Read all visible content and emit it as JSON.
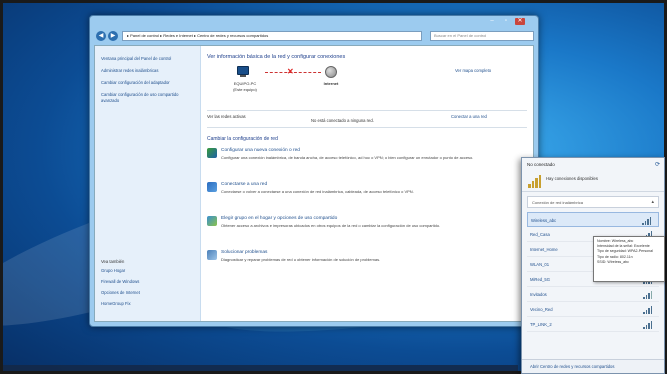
{
  "window": {
    "controls": [
      "–",
      "▫",
      "✕"
    ],
    "address": "▸ Panel de control ▸ Redes e Internet ▸ Centro de redes y recursos compartidos",
    "search_placeholder": "Buscar en el Panel de control"
  },
  "sidebar": {
    "links": [
      "Ventana principal del Panel de control",
      "Administrar redes inalámbricas",
      "Cambiar configuración del adaptador",
      "Cambiar configuración de uso compartido avanzado"
    ],
    "see_also": "Vea también",
    "bottom_links": [
      "Grupo Hogar",
      "Firewall de Windows",
      "Opciones de Internet",
      "HomeGroup Fix"
    ]
  },
  "main": {
    "title": "Ver información básica de la red y configurar conexiones",
    "full_map_link": "Ver mapa completo",
    "pc_label": "EQUIPO-PC",
    "pc_sublabel": "(Este equipo)",
    "internet_label": "Internet",
    "active_networks_label": "Ver las redes activas",
    "connect_link": "Conectar a una red",
    "not_connected": "No está conectado a ninguna red.",
    "change_settings_title": "Cambiar la configuración de red",
    "tasks": [
      {
        "link": "Configurar una nueva conexión o red",
        "desc": "Configurar una conexión inalámbrica, de banda ancha, de acceso telefónico, ad hoc o VPN; o bien configurar un enrutador o punto de acceso."
      },
      {
        "link": "Conectarse a una red",
        "desc": "Conectarse o volver a conectarse a una conexión de red inalámbrica, cableada, de acceso telefónico o VPN."
      },
      {
        "link": "Elegir grupo en el hogar y opciones de uso compartido",
        "desc": "Obtener acceso a archivos e impresoras ubicados en otros equipos de la red o cambiar la configuración de uso compartido."
      },
      {
        "link": "Solucionar problemas",
        "desc": "Diagnosticar y reparar problemas de red u obtener información de solución de problemas."
      }
    ]
  },
  "popup": {
    "status": "No conectado",
    "available_note": "Hay conexiones disponibles",
    "section_label": "Conexión de red inalámbrica",
    "networks": [
      "Wireless_abc",
      "Red_Casa",
      "Internet_Home",
      "WLAN_01",
      "MiRed_5G",
      "Invitados",
      "Vecino_Red",
      "TP_LINK_2"
    ],
    "footer_link": "Abrir Centro de redes y recursos compartidos"
  },
  "tooltip": {
    "lines": [
      "Nombre: Wireless_abc",
      "Intensidad de la señal: Excelente",
      "Tipo de seguridad: WPA2-Personal",
      "Tipo de radio: 802.11n",
      "SSID: Wireless_abc"
    ]
  },
  "colors": {
    "link": "#1e4e8c",
    "title": "#1e3f8c",
    "error": "#d22"
  }
}
